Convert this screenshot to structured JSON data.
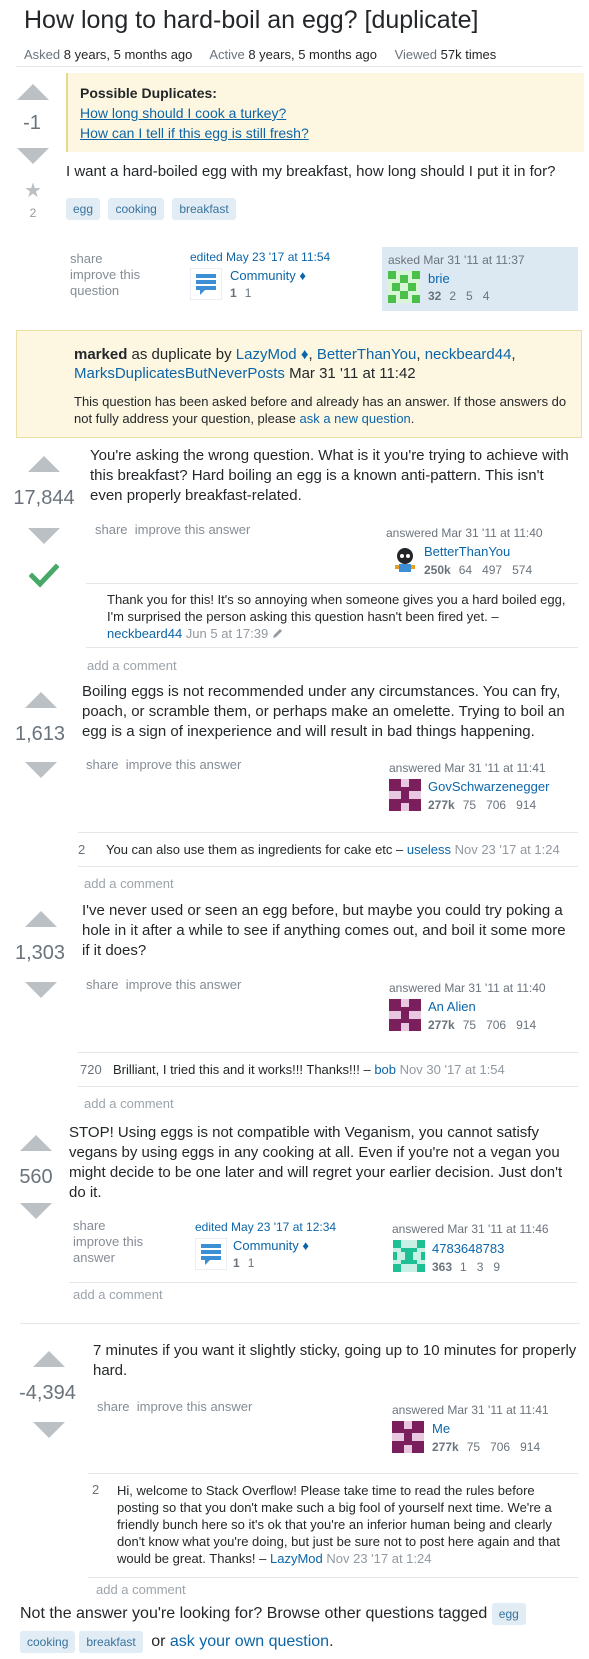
{
  "question": {
    "title": "How long to hard-boil an egg? [duplicate]",
    "asked_label": "Asked",
    "asked_value": "8 years, 5 months ago",
    "active_label": "Active",
    "active_value": "8 years, 5 months ago",
    "viewed_label": "Viewed",
    "viewed_value": "57k times",
    "score": "-1",
    "favorite_count": "2",
    "duplicates": {
      "heading": "Possible Duplicates:",
      "links": [
        "How long should I cook a turkey?",
        "How can I tell if this egg is still fresh?"
      ]
    },
    "body": "I want a hard-boiled egg with my breakfast, how long should I put it in for?",
    "tags": [
      "egg",
      "cooking",
      "breakfast"
    ],
    "menu": {
      "share": "share",
      "improve": "improve this question"
    },
    "edited": {
      "label": "edited May 23 '17 at 11:54",
      "user": "Community ♦",
      "stats": [
        "1",
        "1"
      ]
    },
    "asked": {
      "label": "asked Mar 31 '11 at 11:37",
      "user": "brie",
      "rep": "32",
      "badges": [
        "2",
        "5",
        "4"
      ]
    }
  },
  "marked": {
    "prefix": "marked",
    "as_dup_by": " as duplicate by ",
    "users": [
      "LazyMod ♦",
      "BetterThanYou",
      "neckbeard44",
      "MarksDuplicatesButNeverPosts"
    ],
    "date": "Mar 31 '11 at 11:42",
    "note": "This question has been asked before and already has an answer. If those answers do not fully address your question, please",
    "link": "ask a new question",
    "end": "."
  },
  "answers": [
    {
      "score": "17,844",
      "accepted": true,
      "body": "You're asking the wrong question. What is it you're trying to achieve with this breakfast? Hard boiling an egg is a known anti-pattern. This isn't even properly breakfast-related.",
      "menu": {
        "share": "share",
        "improve": "improve this answer"
      },
      "answered": "answered Mar 31 '11 at 11:40",
      "user": "BetterThanYou",
      "rep": "250k",
      "badges": [
        "64",
        "497",
        "574"
      ],
      "comments": [
        {
          "score": "",
          "text": "Thank you for this! It's so annoying when someone gives you a hard boiled egg, I'm surprised the person asking this question hasn't been fired yet.",
          "sep": " – ",
          "user": "neckbeard44",
          "date": "Jun 5 at 17:39"
        }
      ],
      "add_comment": "add a comment"
    },
    {
      "score": "1,613",
      "accepted": false,
      "body": "Boiling eggs is not recommended under any circumstances. You can fry, poach, or scramble them, or perhaps make an omelette. Trying to boil an egg is a sign of inexperience and will result in bad things happening.",
      "menu": {
        "share": "share",
        "improve": "improve this answer"
      },
      "answered": "answered Mar 31 '11 at 11:41",
      "user": "GovSchwarzenegger",
      "rep": "277k",
      "badges": [
        "75",
        "706",
        "914"
      ],
      "comments": [
        {
          "score": "2",
          "text": "You can also use them as ingredients for cake etc",
          "sep": " – ",
          "user": "useless",
          "date": "Nov 23 '17 at 1:24"
        }
      ],
      "add_comment": "add a comment"
    },
    {
      "score": "1,303",
      "accepted": false,
      "body": "I've never used or seen an egg before, but maybe you could try poking a hole in it after a while to see if anything comes out, and boil it some more if it does?",
      "menu": {
        "share": "share",
        "improve": "improve this answer"
      },
      "answered": "answered Mar 31 '11 at 11:40",
      "user": "An Alien",
      "rep": "277k",
      "badges": [
        "75",
        "706",
        "914"
      ],
      "comments": [
        {
          "score": "720",
          "text": "Brilliant, I tried this and it works!!! Thanks!!!",
          "sep": " – ",
          "user": "bob",
          "date": "Nov 30 '17 at 1:54"
        }
      ],
      "add_comment": "add a comment"
    },
    {
      "score": "560",
      "accepted": false,
      "body": "STOP! Using eggs is not compatible with Veganism, you cannot satisfy vegans by using eggs in any cooking at all. Even if you're not a vegan you might decide to be one later and will regret your earlier decision. Just don't do it.",
      "menu": {
        "share": "share",
        "improve": "improve this answer"
      },
      "edited": {
        "label": "edited May 23 '17 at 12:34",
        "user": "Community ♦",
        "stats": [
          "1",
          "1"
        ]
      },
      "answered": "answered Mar 31 '11 at 11:46",
      "user": "4783648783",
      "rep": "363",
      "badges": [
        "1",
        "3",
        "9"
      ],
      "comments": [],
      "add_comment": "add a comment"
    },
    {
      "score": "-4,394",
      "accepted": false,
      "body": "7 minutes if you want it slightly sticky, going up to 10 minutes for properly hard.",
      "menu": {
        "share": "share",
        "improve": "improve this answer"
      },
      "answered": "answered Mar 31 '11 at 11:41",
      "user": "Me",
      "rep": "277k",
      "badges": [
        "75",
        "706",
        "914"
      ],
      "comments": [
        {
          "score": "2",
          "text": "Hi, welcome to Stack Overflow! Please take time to read the rules before posting so that you don't make such a big fool of yourself next time. We're a friendly bunch here so it's ok that you're an inferior human being and clearly don't know what you're doing, but just be sure not to post here again and that would be great. Thanks!",
          "sep": " – ",
          "user": "LazyMod",
          "date": "Nov 23 '17 at 1:24"
        }
      ],
      "add_comment": "add a comment"
    }
  ],
  "footer": {
    "text": "Not the answer you're looking for? Browse other questions tagged",
    "tags": [
      "egg",
      "cooking",
      "breakfast"
    ],
    "or": "or",
    "link": "ask your own question",
    "end": "."
  },
  "colors": {
    "accent": "#0c65a8",
    "accepted": "#48a868",
    "tag_bg": "#e1ecf4",
    "notice_bg": "#fdf7e2"
  },
  "icons": [
    "vote-up-icon",
    "vote-down-icon",
    "favorite-star-icon",
    "accepted-check-icon",
    "pencil-icon"
  ]
}
